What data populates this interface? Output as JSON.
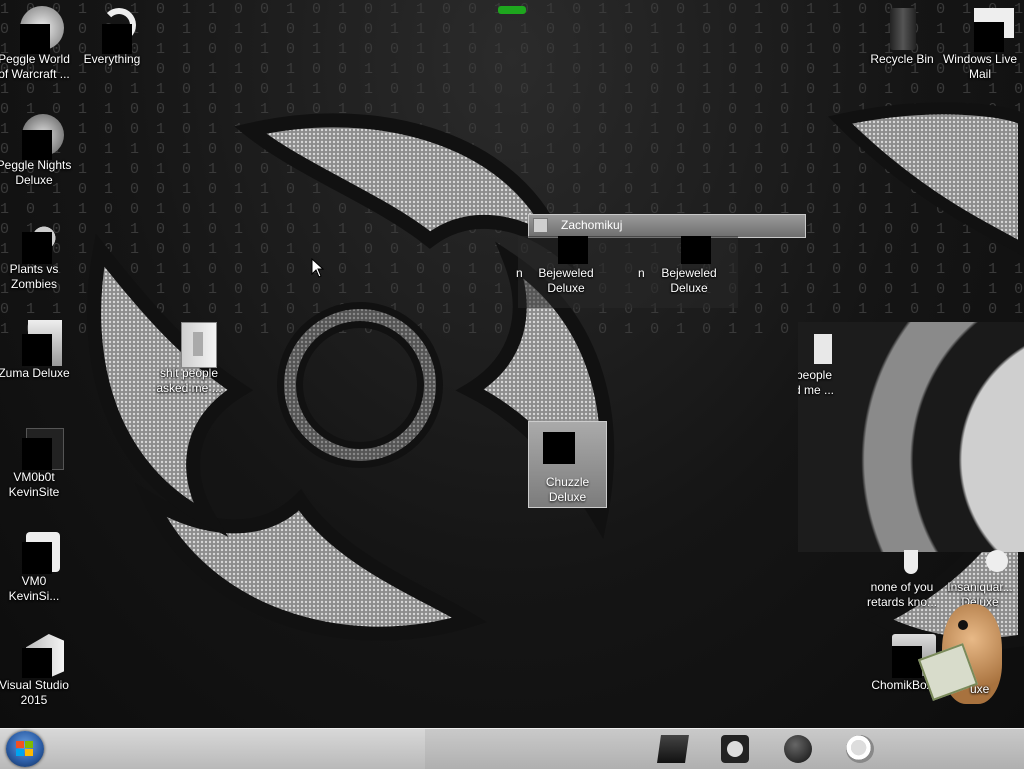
{
  "desktop": {
    "icons": [
      {
        "name": "peggle-world-of-warcraft-icon",
        "label": "Peggle World\nof Warcraft ..."
      },
      {
        "name": "everything-icon",
        "label": "Everything"
      },
      {
        "name": "peggle-nights-deluxe-icon",
        "label": "Peggle Nights\nDeluxe"
      },
      {
        "name": "plants-vs-zombies-icon",
        "label": "Plants vs\nZombies"
      },
      {
        "name": "zuma-deluxe-icon",
        "label": "Zuma Deluxe"
      },
      {
        "name": "folder-icon",
        "label": "shit people\nasked me ..."
      },
      {
        "name": "vm0b0t-kevinsite-icon",
        "label": "VM0b0t\nKevinSite"
      },
      {
        "name": "vm0-kevinsite-icon",
        "label": "VM0\nKevinSi..."
      },
      {
        "name": "visual-studio-icon",
        "label": "Visual Studio\n2015"
      },
      {
        "name": "recycle-bin-icon",
        "label": "Recycle Bin"
      },
      {
        "name": "windows-live-mail-icon",
        "label": "Windows Live\nMail"
      },
      {
        "name": "none-of-you-icon",
        "label": "none of you\nretards kno..."
      },
      {
        "name": "insaniquarium-icon",
        "label": "Insaniquar...\nDeluxe"
      },
      {
        "name": "chomikbox-icon",
        "label": "ChomikBox"
      },
      {
        "name": "deluxe-partial-icon",
        "label": "uxe"
      }
    ],
    "fence": {
      "title": "Zachomikuj",
      "items": [
        {
          "label": "Bejeweled\nDeluxe"
        },
        {
          "label": "Bejeweled\nDeluxe"
        },
        {
          "label": "Chuzzle\nDeluxe"
        }
      ],
      "partial_left": "n",
      "partial_mid": "n"
    },
    "ghost_label": "people\nd me ..."
  },
  "taskbar": {
    "start_label": "Start",
    "pinned": [
      {
        "name": "explorer-icon"
      },
      {
        "name": "media-icon"
      },
      {
        "name": "globe-icon"
      },
      {
        "name": "firefox-icon"
      }
    ]
  },
  "colors": {
    "taskbar": "#c8c8c8",
    "fence_title": "#8a8a8a",
    "start_orb": "#2d5fa8"
  }
}
